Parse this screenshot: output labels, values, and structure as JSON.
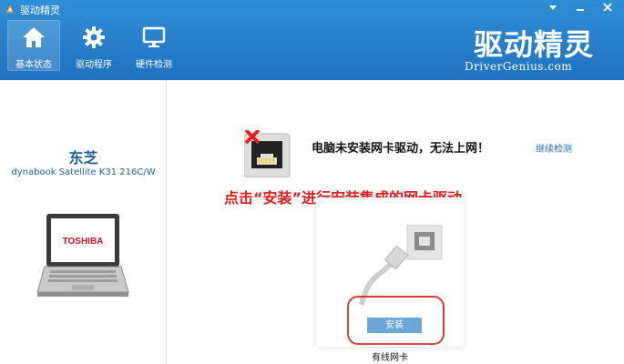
{
  "app": {
    "title": "驱动精灵"
  },
  "nav": {
    "items": [
      {
        "label": "基本状态",
        "icon": "home-icon",
        "active": true
      },
      {
        "label": "驱动程序",
        "icon": "gear-icon",
        "active": false
      },
      {
        "label": "硬件检测",
        "icon": "monitor-icon",
        "active": false
      }
    ]
  },
  "logo": {
    "main": "驱动精灵",
    "sub": "DriverGenius.com"
  },
  "device": {
    "brand": "东芝",
    "model": "dynabook Satellite K31 216C/W",
    "screen_logo": "TOSHIBA"
  },
  "status": {
    "message": "电脑未安装网卡驱动，无法上网！",
    "recheck_label": "继续检测"
  },
  "annotation": {
    "text": "点击“安装”进行安装集成的网卡驱动"
  },
  "card": {
    "install_label": "安装",
    "caption": "有线网卡"
  },
  "colors": {
    "header": "#1f72bf",
    "accent": "#2a74b8",
    "annotation": "#e01b1b",
    "button": "#6aa6d8"
  }
}
